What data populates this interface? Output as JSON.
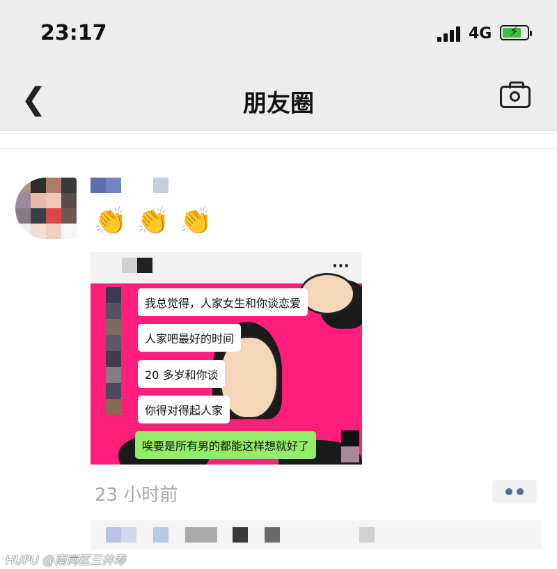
{
  "status_bar": {
    "time": "23:17",
    "network": "4G"
  },
  "nav": {
    "title": "朋友圈",
    "back_icon": "chevron-left-icon",
    "camera_icon": "camera-icon"
  },
  "post": {
    "emoji_text": "👏👏👏",
    "time_ago": "23 小时前",
    "screenshot": {
      "more_label": "···",
      "messages": [
        {
          "text": "我总觉得，人家女生和你谈恋爱",
          "color": "#ffffff"
        },
        {
          "text": "人家吧最好的时间",
          "color": "#ffffff"
        },
        {
          "text": "20 多岁和你谈",
          "color": "#ffffff"
        },
        {
          "text": "你得对得起人家",
          "color": "#ffffff"
        },
        {
          "text": "唉要是所有男的都能这样想就好了",
          "color": "#95ec69"
        }
      ],
      "background_color": "#ff1f7a"
    },
    "action_icon": "more-dots-icon"
  },
  "watermark": "HUPU @南岗区三井寿",
  "colors": {
    "accent_link": "#576b95",
    "nav_bg": "#ededed"
  }
}
